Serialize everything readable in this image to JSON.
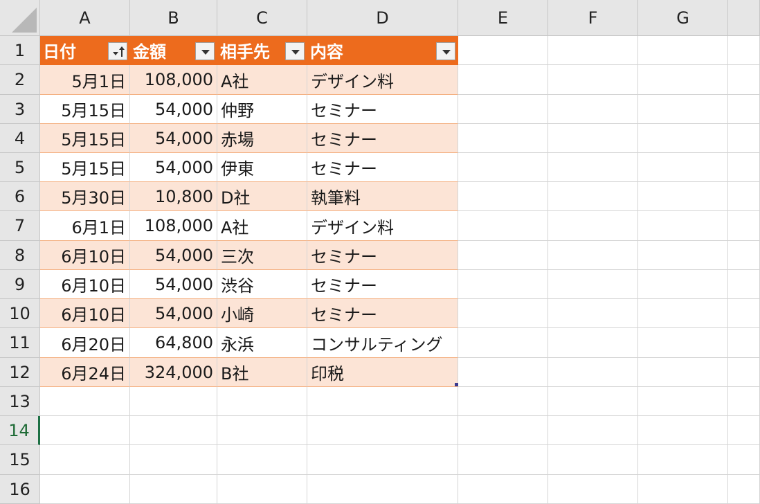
{
  "columns": [
    "A",
    "B",
    "C",
    "D",
    "E",
    "F",
    "G"
  ],
  "rows": [
    "1",
    "2",
    "3",
    "4",
    "5",
    "6",
    "7",
    "8",
    "9",
    "10",
    "11",
    "12",
    "13",
    "14",
    "15",
    "16"
  ],
  "active_row": "14",
  "table": {
    "headers": [
      "日付",
      "金額",
      "相手先",
      "内容"
    ],
    "sort_column": "日付",
    "rows": [
      [
        "5月1日",
        "108,000",
        "A社",
        "デザイン料"
      ],
      [
        "5月15日",
        "54,000",
        "仲野",
        "セミナー"
      ],
      [
        "5月15日",
        "54,000",
        "赤場",
        "セミナー"
      ],
      [
        "5月15日",
        "54,000",
        "伊東",
        "セミナー"
      ],
      [
        "5月30日",
        "10,800",
        "D社",
        "執筆料"
      ],
      [
        "6月1日",
        "108,000",
        "A社",
        "デザイン料"
      ],
      [
        "6月10日",
        "54,000",
        "三次",
        "セミナー"
      ],
      [
        "6月10日",
        "54,000",
        "渋谷",
        "セミナー"
      ],
      [
        "6月10日",
        "54,000",
        "小崎",
        "セミナー"
      ],
      [
        "6月20日",
        "64,800",
        "永浜",
        "コンサルティング"
      ],
      [
        "6月24日",
        "324,000",
        "B社",
        "印税"
      ]
    ]
  },
  "colors": {
    "header_fill": "#ed6b1d",
    "band_fill": "#fce4d6",
    "border": "#f4b183",
    "active_row_marker": "#1e7145"
  },
  "icons": [
    "filter-sort-ascending-icon",
    "filter-dropdown-icon"
  ]
}
